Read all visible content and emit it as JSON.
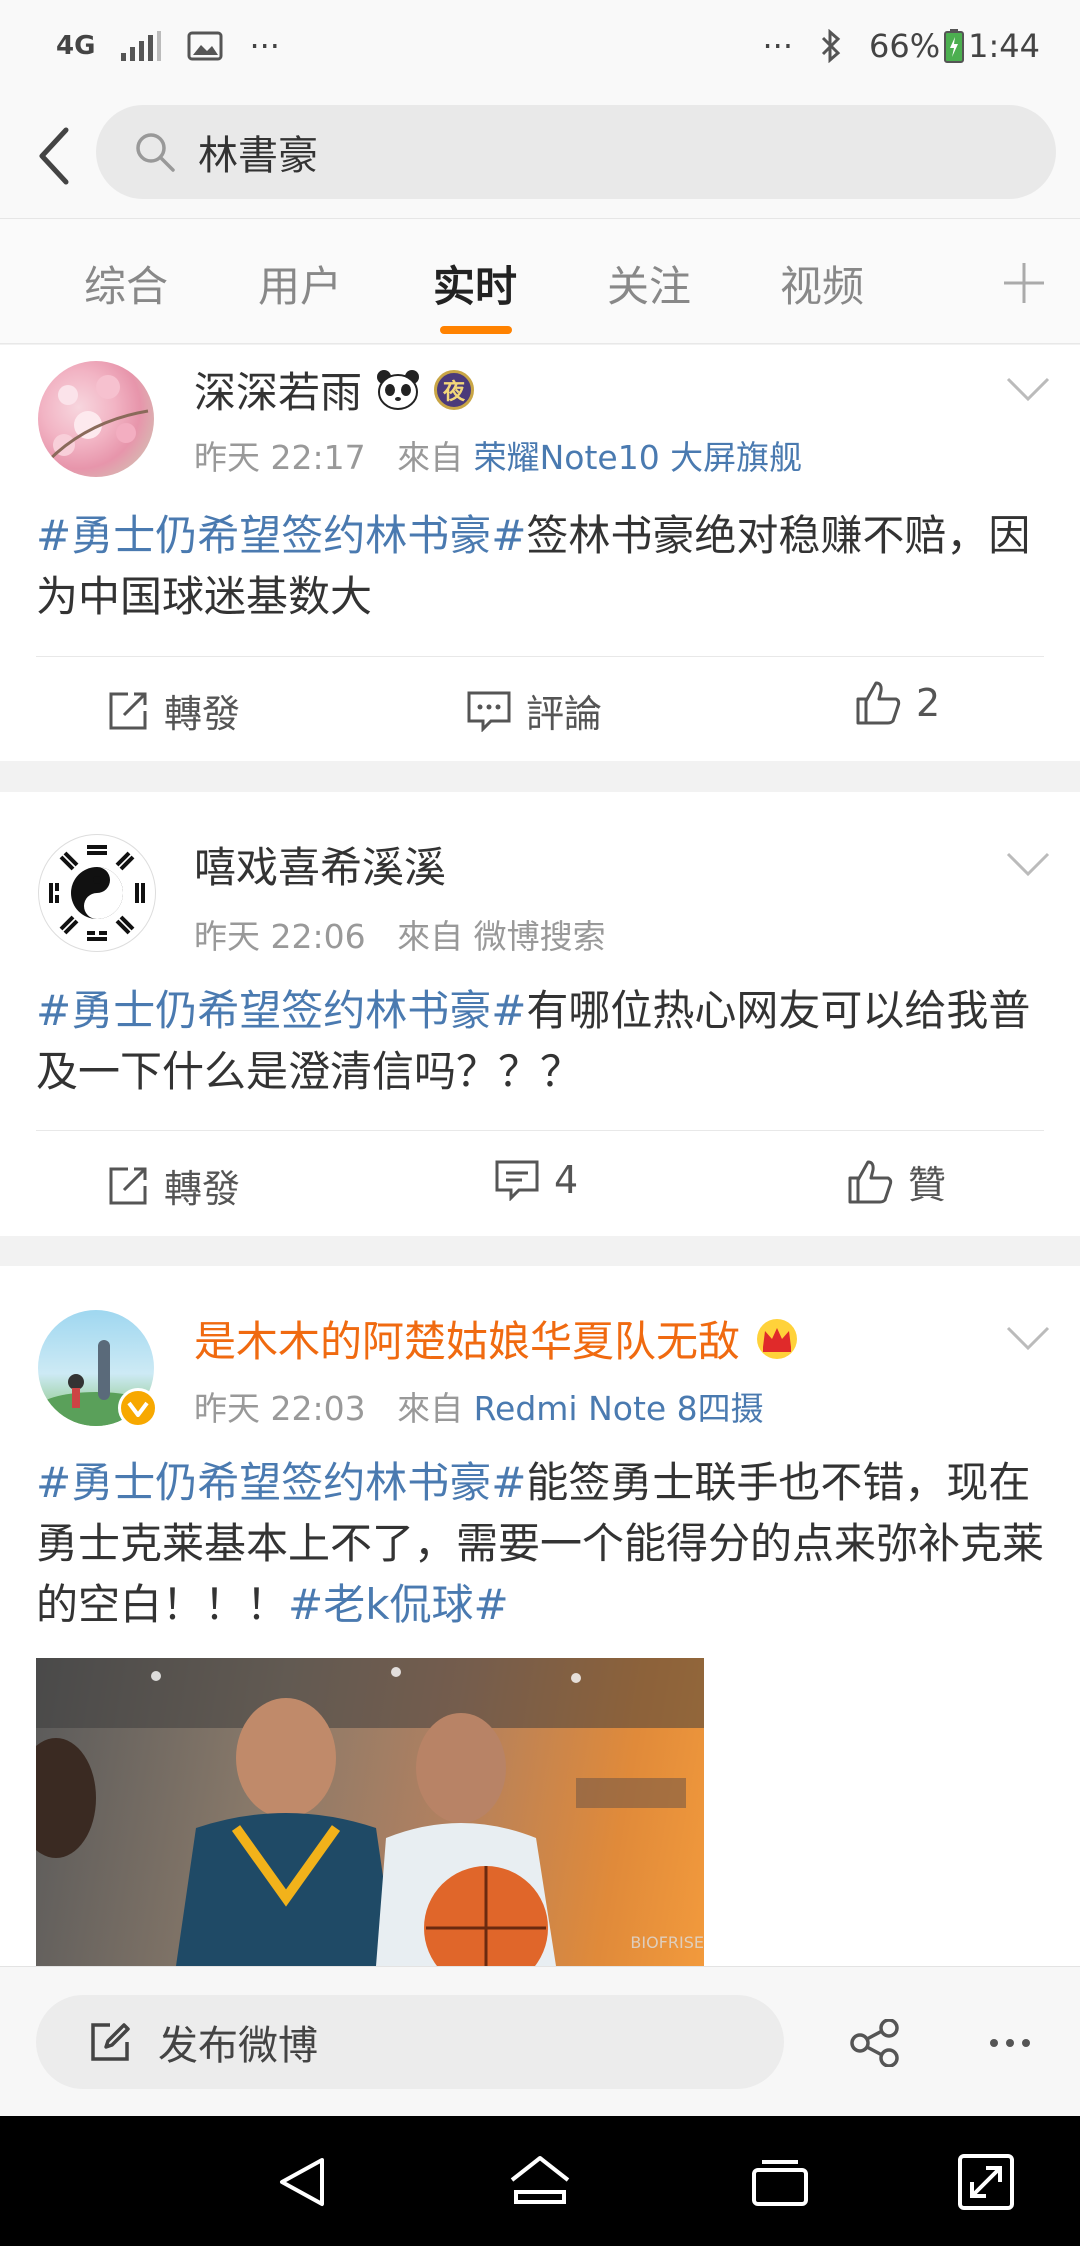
{
  "status_bar": {
    "network": "4G",
    "ellipsis": "···",
    "notif_ellipsis": "···",
    "battery": "66%",
    "time": "1:44"
  },
  "search": {
    "query": "林書豪"
  },
  "tabs": [
    {
      "label": "综合"
    },
    {
      "label": "用户"
    },
    {
      "label": "实时"
    },
    {
      "label": "关注"
    },
    {
      "label": "视频"
    }
  ],
  "active_tab": "实时",
  "posts": [
    {
      "username": "深深若雨",
      "badge": "夜",
      "time": "昨天 22:17",
      "from": "來自",
      "source": "荣耀Note10 大屏旗舰",
      "hashtag": "#勇士仍希望签约林书豪#",
      "text": "签林书豪绝对稳赚不赔，因为中国球迷基数大",
      "repost": "轉發",
      "comment": "評論",
      "likes": "2"
    },
    {
      "username": "嘻戏喜希溪溪",
      "time": "昨天 22:06",
      "from": "來自",
      "source": "微博搜索",
      "hashtag": "#勇士仍希望签约林书豪#",
      "text": "有哪位热心网友可以给我普及一下什么是澄清信吗？？？",
      "repost": "轉發",
      "comment": "4",
      "likes": "贊"
    },
    {
      "username": "是木木的阿楚姑娘华夏队无敌",
      "time": "昨天 22:03",
      "from": "來自",
      "source": "Redmi Note 8四摄",
      "hashtag": "#勇士仍希望签约林书豪#",
      "text": "能签勇士联手也不错，现在勇士克莱基本上不了，需要一个能得分的点来弥补克莱的空白！！！",
      "hashtag2": "#老k侃球#",
      "image_watermark": "BIOFRISE"
    }
  ],
  "bottom_bar": {
    "compose": "发布微博"
  },
  "colors": {
    "accent": "#ff8200",
    "link": "#4a7ab0",
    "vip_name": "#f06a10"
  }
}
